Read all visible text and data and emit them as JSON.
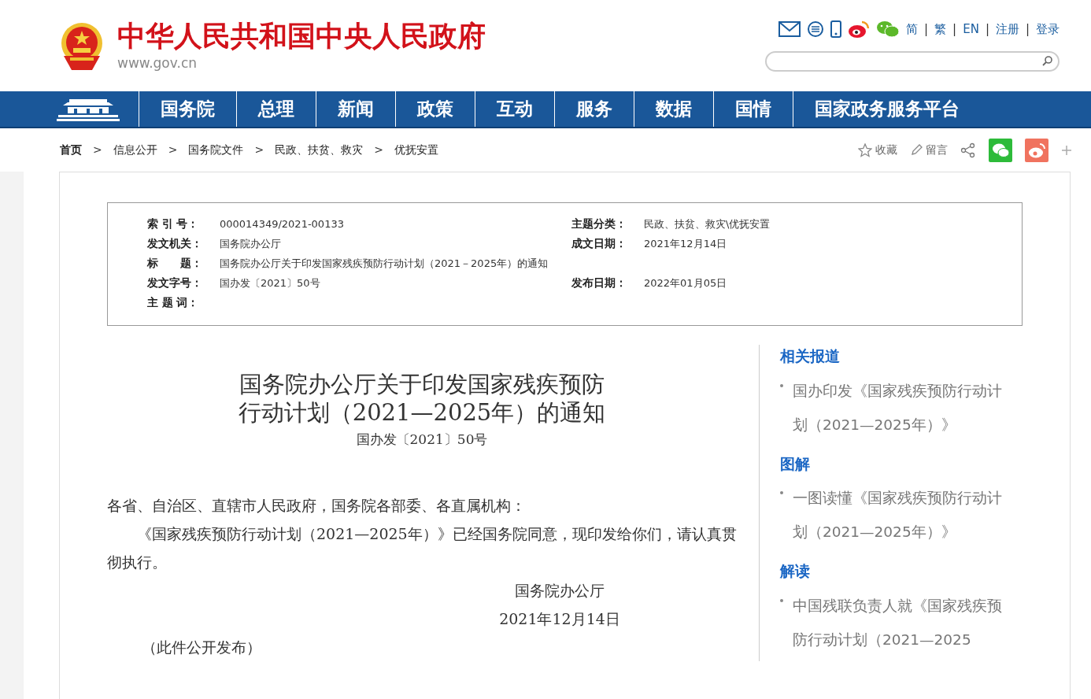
{
  "header": {
    "site_title": "中华人民共和国中央人民政府",
    "site_url": "www.gov.cn",
    "lang_links": [
      "简",
      "繁",
      "EN",
      "注册",
      "登录"
    ],
    "link_separator": "|"
  },
  "nav": {
    "items": [
      "国务院",
      "总理",
      "新闻",
      "政策",
      "互动",
      "服务",
      "数据",
      "国情",
      "国家政务服务平台"
    ]
  },
  "breadcrumb": {
    "items": [
      {
        "label": "首页",
        "kind": "home"
      },
      {
        "label": "信息公开",
        "kind": "link"
      },
      {
        "label": "国务院文件",
        "kind": "link"
      },
      {
        "label": "民政、扶贫、救灾",
        "kind": "link"
      },
      {
        "label": "优抚安置",
        "kind": "link"
      }
    ],
    "separator": ">"
  },
  "tools": [
    "收藏",
    "留言"
  ],
  "meta": {
    "left": [
      {
        "label": "索 引 号：",
        "value": "000014349/2021-00133"
      },
      {
        "label": "发文机关：",
        "value": "国务院办公厅"
      },
      {
        "label": "标　　题：",
        "value": "国务院办公厅关于印发国家残疾预防行动计划（2021－2025年）的通知"
      },
      {
        "label": "发文字号：",
        "value": "国办发〔2021〕50号"
      },
      {
        "label": "主 题 词："
      }
    ],
    "right": [
      {
        "label": "主题分类：",
        "value": "民政、扶贫、救灾\\优抚安置"
      },
      {
        "label": "成文日期：",
        "value": "2021年12月14日"
      },
      {
        "label": "发布日期：",
        "value": "2022年01月05日"
      }
    ]
  },
  "article": {
    "title_lines": [
      "国务院办公厅关于印发国家残疾预防",
      "行动计划（2021—2025年）的通知"
    ],
    "doc_number": "国办发〔2021〕50号",
    "salutation": "各省、自治区、直辖市人民政府，国务院各部委、各直属机构：",
    "body": "《国家残疾预防行动计划（2021—2025年）》已经国务院同意，现印发给你们，请认真贯彻执行。",
    "signature": "国务院办公厅",
    "date": "2021年12月14日",
    "note": "（此件公开发布）"
  },
  "sidebar": [
    {
      "heading": "相关报道",
      "items": [
        "国办印发《国家残疾预防行动计划（2021—2025年）》"
      ]
    },
    {
      "heading": "图解",
      "items": [
        "一图读懂《国家残疾预防行动计划（2021—2025年）》"
      ]
    },
    {
      "heading": "解读",
      "items": [
        "中国残联负责人就《国家残疾预防行动计划（2021—2025"
      ]
    }
  ]
}
